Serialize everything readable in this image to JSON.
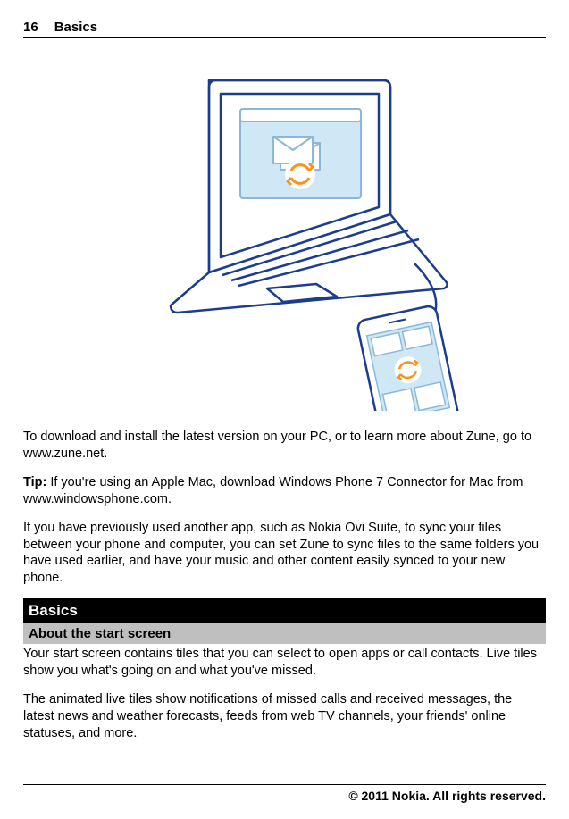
{
  "header": {
    "page_number": "16",
    "title": "Basics"
  },
  "paragraphs": {
    "p1": "To download and install the latest version on your PC, or to learn more about Zune, go to www.zune.net.",
    "tip_label": "Tip:",
    "tip_text": " If you're using an Apple Mac, download Windows Phone 7 Connector for Mac from www.windowsphone.com.",
    "p3": "If you have previously used another app, such as Nokia Ovi Suite, to sync your files between your phone and computer, you can set Zune to sync files to the same folders you have used earlier, and have your music and other content easily synced to your new phone.",
    "p4": "Your start screen contains tiles that you can select to open apps or call contacts. Live tiles show you what's going on and what you've missed.",
    "p5": "The animated live tiles show notifications of missed calls and received messages, the latest news and weather forecasts, feeds from web TV channels, your friends' online statuses, and more."
  },
  "headings": {
    "section": "Basics",
    "subsection": "About the start screen"
  },
  "footer": {
    "copyright": "© 2011 Nokia. All rights reserved."
  }
}
